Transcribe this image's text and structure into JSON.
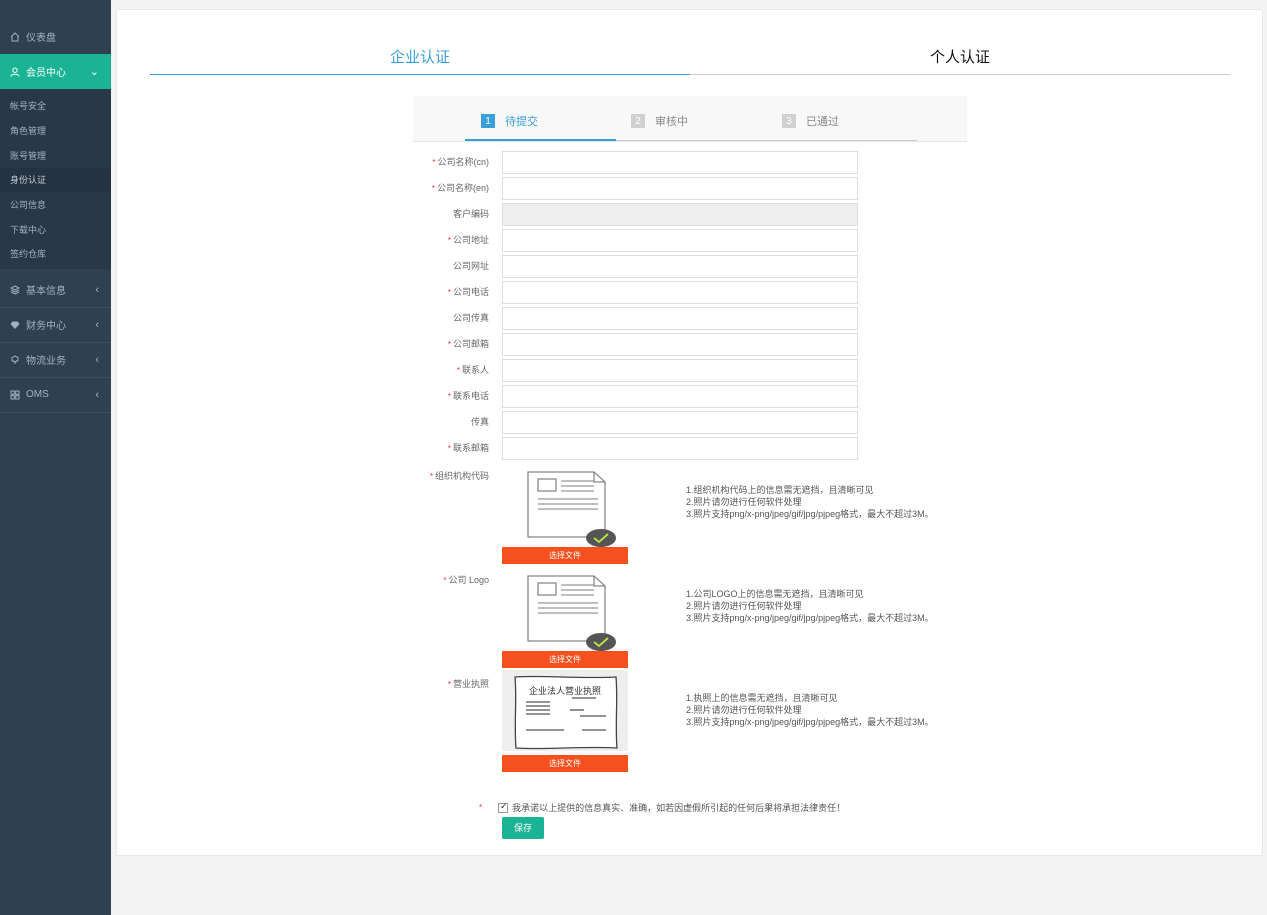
{
  "sidebar": {
    "dashboard": "仪表盘",
    "member_center": "会员中心",
    "sub_items": [
      "帐号安全",
      "角色管理",
      "账号管理",
      "身份认证",
      "公司信息",
      "下载中心",
      "签约仓库"
    ],
    "basic_info": "基本信息",
    "finance": "财务中心",
    "logistics": "物流业务",
    "oms": "OMS"
  },
  "tabs": {
    "enterprise": "企业认证",
    "personal": "个人认证"
  },
  "steps": [
    {
      "num": "1",
      "label": "待提交"
    },
    {
      "num": "2",
      "label": "审核中"
    },
    {
      "num": "3",
      "label": "已通过"
    }
  ],
  "form": {
    "fields": [
      {
        "label": "公司名称(cn)",
        "required": "*",
        "value": ""
      },
      {
        "label": "公司名称(en)",
        "required": "*",
        "value": ""
      },
      {
        "label": "客户编码",
        "required": "",
        "value": ""
      },
      {
        "label": "公司地址",
        "required": "*",
        "value": ""
      },
      {
        "label": "公司网址",
        "required": "",
        "value": ""
      },
      {
        "label": "公司电话",
        "required": "*",
        "value": ""
      },
      {
        "label": "公司传真",
        "required": "",
        "value": ""
      },
      {
        "label": "公司邮箱",
        "required": "*",
        "value": ""
      },
      {
        "label": "联系人",
        "required": "*",
        "value": ""
      },
      {
        "label": "联系电话",
        "required": "*",
        "value": ""
      },
      {
        "label": "传真",
        "required": "",
        "value": ""
      },
      {
        "label": "联系邮箱",
        "required": "*",
        "value": ""
      }
    ]
  },
  "uploads": [
    {
      "label": "组织机构代码",
      "required": "*",
      "button": "选择文件",
      "hints": [
        "1.组织机构代码上的信息需无遮挡，且清晰可见",
        "2.照片请勿进行任何软件处理",
        "3.照片支持png/x-png/jpeg/gif/jpg/pjpeg格式，最大不超过3M。"
      ]
    },
    {
      "label": "公司 Logo",
      "required": "*",
      "button": "选择文件",
      "hints": [
        "1.公司LOGO上的信息需无遮挡，且清晰可见",
        "2.照片请勿进行任何软件处理",
        "3.照片支持png/x-png/jpeg/gif/jpg/pjpeg格式，最大不超过3M。"
      ]
    },
    {
      "label": "营业执照",
      "required": "*",
      "button": "选择文件",
      "license_title": "企业法人营业执照",
      "hints": [
        "1.执照上的信息需无遮挡，且清晰可见",
        "2.照片请勿进行任何软件处理",
        "3.照片支持png/x-png/jpeg/gif/jpg/pjpeg格式，最大不超过3M。"
      ]
    }
  ],
  "agreement": {
    "required": "*",
    "text": "我承诺以上提供的信息真实、准确，如若因虚假所引起的任何后果将承担法律责任！",
    "checked": true
  },
  "save_label": "保存",
  "colors": {
    "sidebar_bg": "#2f4050",
    "accent_green": "#1ab394",
    "accent_blue": "#3a9fd8",
    "upload_orange": "#f4511e"
  }
}
